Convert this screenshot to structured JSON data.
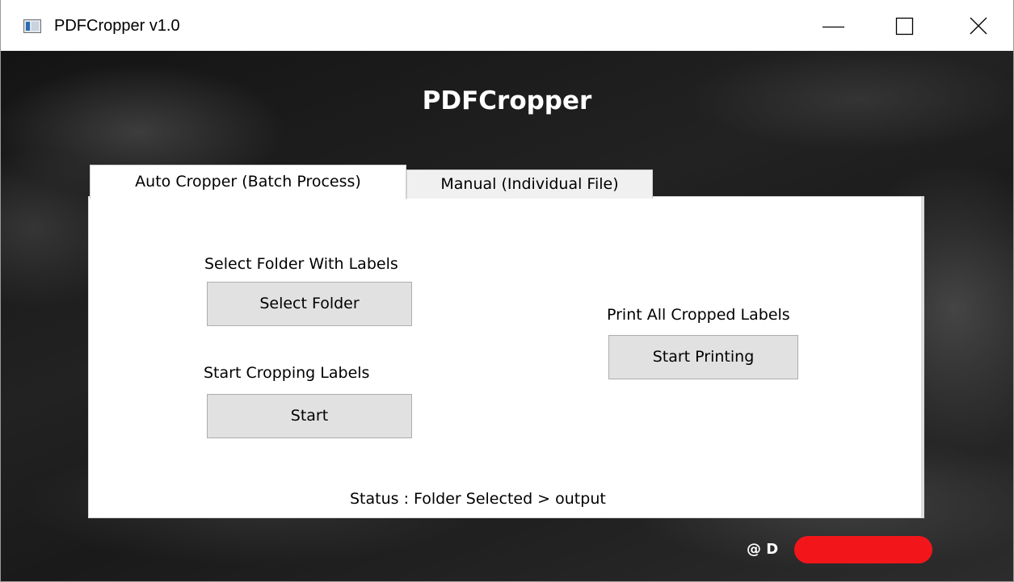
{
  "window": {
    "title": "PDFCropper v1.0",
    "controls": [
      "minimize-icon",
      "maximize-icon",
      "close-icon"
    ]
  },
  "app": {
    "heading": "PDFCropper"
  },
  "tabs": [
    {
      "label": "Auto Cropper (Batch Process)",
      "selected": true
    },
    {
      "label": "Manual (Individual File)",
      "selected": false
    }
  ],
  "auto_tab": {
    "select_folder_label": "Select Folder With Labels",
    "select_folder_button": "Select Folder",
    "start_cropping_label": "Start Cropping Labels",
    "start_button": "Start",
    "print_label": "Print All Cropped Labels",
    "print_button": "Start Printing",
    "status": "Status : Folder Selected > output"
  },
  "footer": {
    "credit": "@ D"
  },
  "colors": {
    "redaction": "#f2161b",
    "button_bg": "#e1e1e1",
    "background": "#1c1c1c"
  }
}
